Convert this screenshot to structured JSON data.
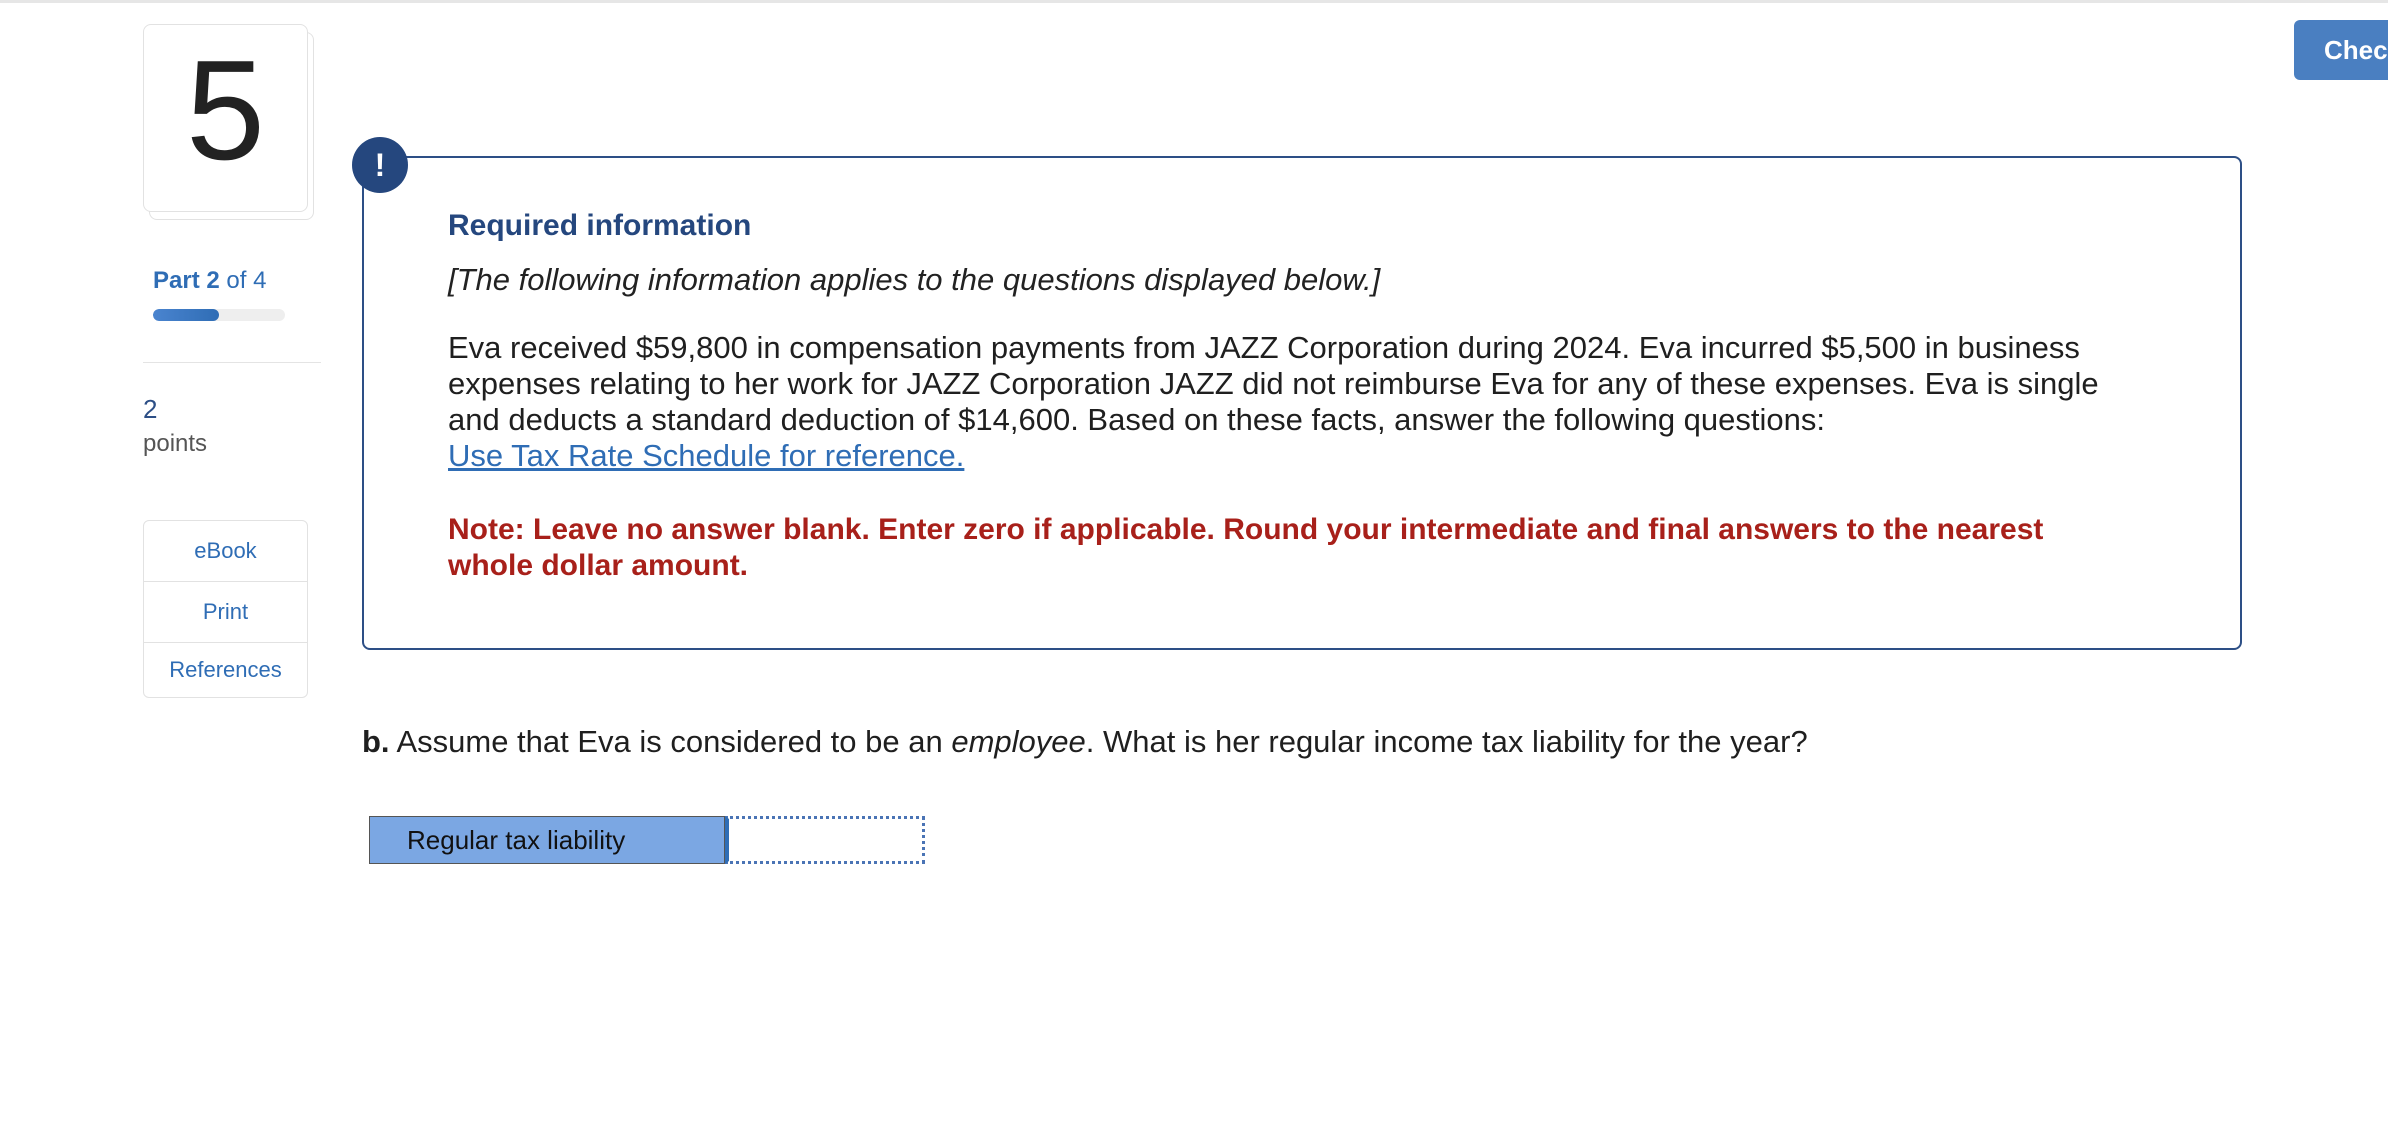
{
  "question": {
    "number": "5"
  },
  "part": {
    "prefix": "Part",
    "current": "2",
    "suffix": "of 4",
    "progress_fraction": 0.5
  },
  "points": {
    "value": "2",
    "label": "points"
  },
  "tools": [
    {
      "label": "eBook"
    },
    {
      "label": "Print"
    },
    {
      "label": "References"
    }
  ],
  "check_button": {
    "label": "Chec"
  },
  "info": {
    "badge": "!",
    "title": "Required information",
    "applies": "[The following information applies to the questions displayed below.]",
    "body": "Eva received $59,800 in compensation payments from JAZZ Corporation during 2024. Eva incurred $5,500 in business expenses relating to her work for JAZZ Corporation JAZZ did not reimburse Eva for any of these expenses. Eva is single and deducts a standard deduction of $14,600. Based on these facts, answer the following questions:",
    "link": "Use Tax Rate Schedule for reference.",
    "note": "Note: Leave no answer blank. Enter zero if applicable. Round your intermediate and final answers to the nearest whole dollar amount."
  },
  "question_b": {
    "letter": "b.",
    "text_before": " Assume that Eva is considered to be an ",
    "emphasis": "employee",
    "text_after": ". What is her regular income tax liability for the year?"
  },
  "answer": {
    "label": "Regular tax liability",
    "value": ""
  }
}
